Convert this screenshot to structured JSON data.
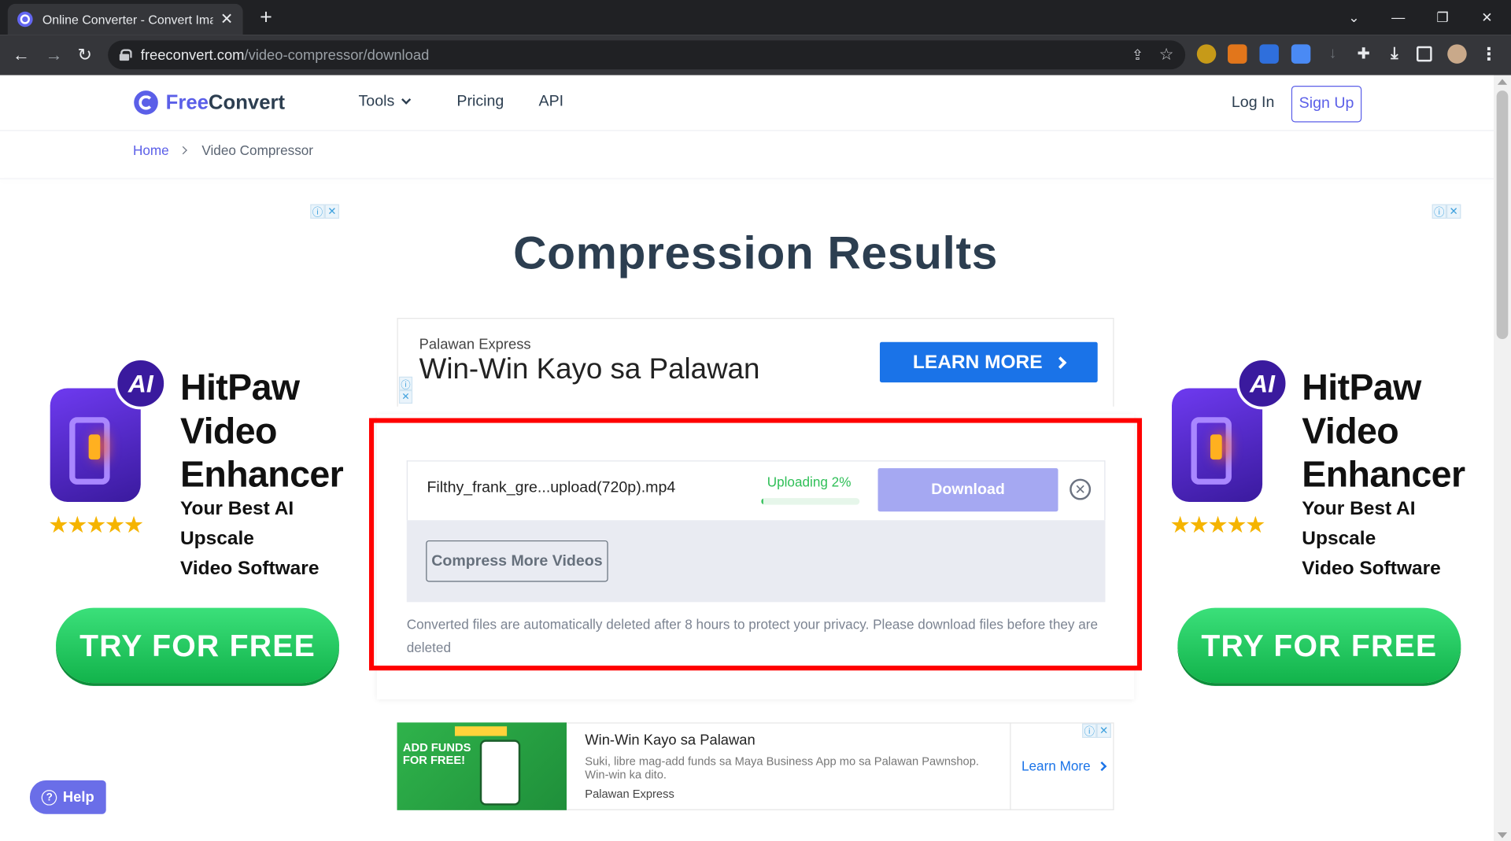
{
  "browser": {
    "tab_title": "Online Converter - Convert Imag",
    "tab_close": "✕",
    "new_tab": "+",
    "url_host": "freeconvert.com",
    "url_path": "/video-compressor/download",
    "back": "←",
    "forward": "→",
    "reload": "↻",
    "win_dropdown": "⌄",
    "win_min": "—",
    "win_max": "❐",
    "win_close": "✕",
    "share_icon": "⇪",
    "star_icon": "☆",
    "ext_puzzle": "✚",
    "ext_download": "⤓",
    "menu_icon": "⋮"
  },
  "header": {
    "logo_free": "Free",
    "logo_convert": "Convert",
    "nav": {
      "tools": "Tools",
      "pricing": "Pricing",
      "api": "API"
    },
    "login": "Log In",
    "signup": "Sign Up"
  },
  "breadcrumb": {
    "home": "Home",
    "current": "Video Compressor"
  },
  "page": {
    "heading": "Compression Results"
  },
  "ad_choices": {
    "info": "ⓘ",
    "close": "✕"
  },
  "side_ad": {
    "badge": "AI",
    "title_line1": "HitPaw",
    "title_line2": "Video",
    "title_line3": "Enhancer",
    "sub_line1": "Your Best AI Upscale",
    "sub_line2": "Video Software",
    "stars": "★★★★★",
    "cta": "TRY FOR FREE"
  },
  "top_ad": {
    "brand": "Palawan Express",
    "title": "Win-Win Kayo sa Palawan",
    "cta": "LEARN MORE"
  },
  "result": {
    "filename": "Filthy_frank_gre...upload(720p).mp4",
    "status": "Uploading 2%",
    "progress": 0.02,
    "download": "Download",
    "remove": "✕",
    "compress_more": "Compress More Videos",
    "notice": "Converted files are automatically deleted after 8 hours to protect your privacy. Please download files before they are deleted"
  },
  "bottom_ad": {
    "img_text": "ADD FUNDS FOR FREE!",
    "title": "Win-Win Kayo sa Palawan",
    "desc": "Suki, libre mag-add funds sa Maya Business App mo sa Palawan Pawnshop. Win-win ka dito.",
    "brand": "Palawan Express",
    "cta": "Learn More"
  },
  "help": {
    "icon": "?",
    "label": "Help"
  },
  "colors": {
    "brand": "#5b5fe8",
    "highlight": "#ff0000",
    "progress": "#2fbf57",
    "cta_green": "#12b34b"
  }
}
